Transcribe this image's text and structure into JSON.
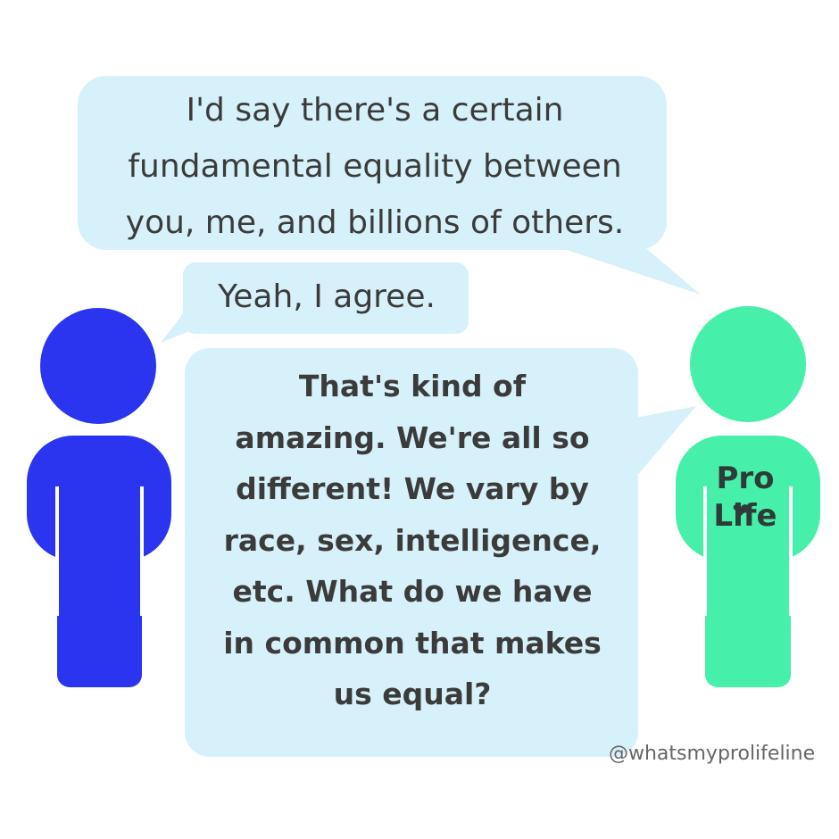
{
  "bubbles": {
    "top": [
      "I'd say there's a certain",
      "fundamental equality between",
      "you, me, and billions of others."
    ],
    "reply": "Yeah, I agree.",
    "question": [
      "That's kind of",
      "amazing. We're all so",
      "different! We vary by",
      "race, sex, intelligence,",
      "etc. What do we have",
      "in common that makes",
      "us equal?"
    ]
  },
  "figures": {
    "left": {
      "color": "#2b35f0"
    },
    "right": {
      "color": "#46f0aa",
      "shirt_lines": [
        "Pro",
        "Life"
      ]
    }
  },
  "bubble_color": "#d7f1fb",
  "handle": "@whatsmyprolifeline"
}
